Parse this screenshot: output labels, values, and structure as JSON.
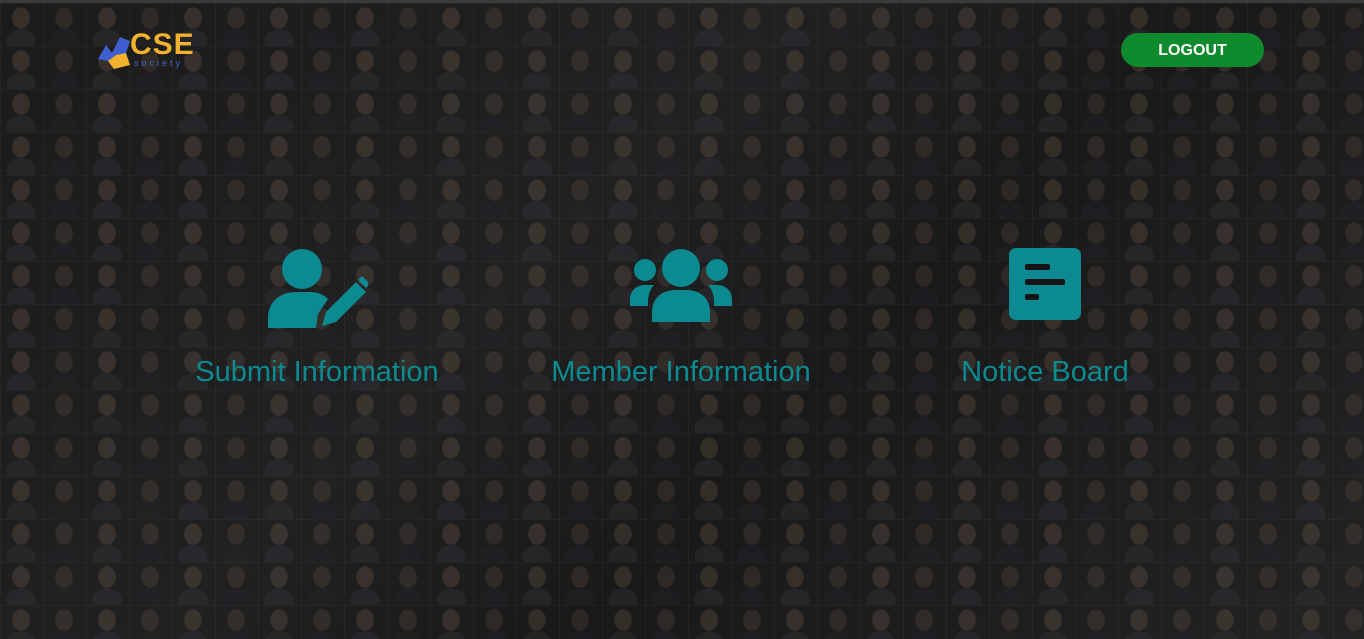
{
  "header": {
    "logo_text": "CSE",
    "logo_subtext": "society",
    "logout_label": "LOGOUT"
  },
  "menu": {
    "items": [
      {
        "label": "Submit Information",
        "icon": "user-edit-icon"
      },
      {
        "label": "Member Information",
        "icon": "users-group-icon"
      },
      {
        "label": "Notice Board",
        "icon": "notice-board-icon"
      }
    ]
  },
  "colors": {
    "accent": "#0b8a91",
    "logout_button": "#0f8a2c",
    "logo_primary": "#f2b12e",
    "logo_secondary": "#4a63c9",
    "background": "#141414"
  }
}
